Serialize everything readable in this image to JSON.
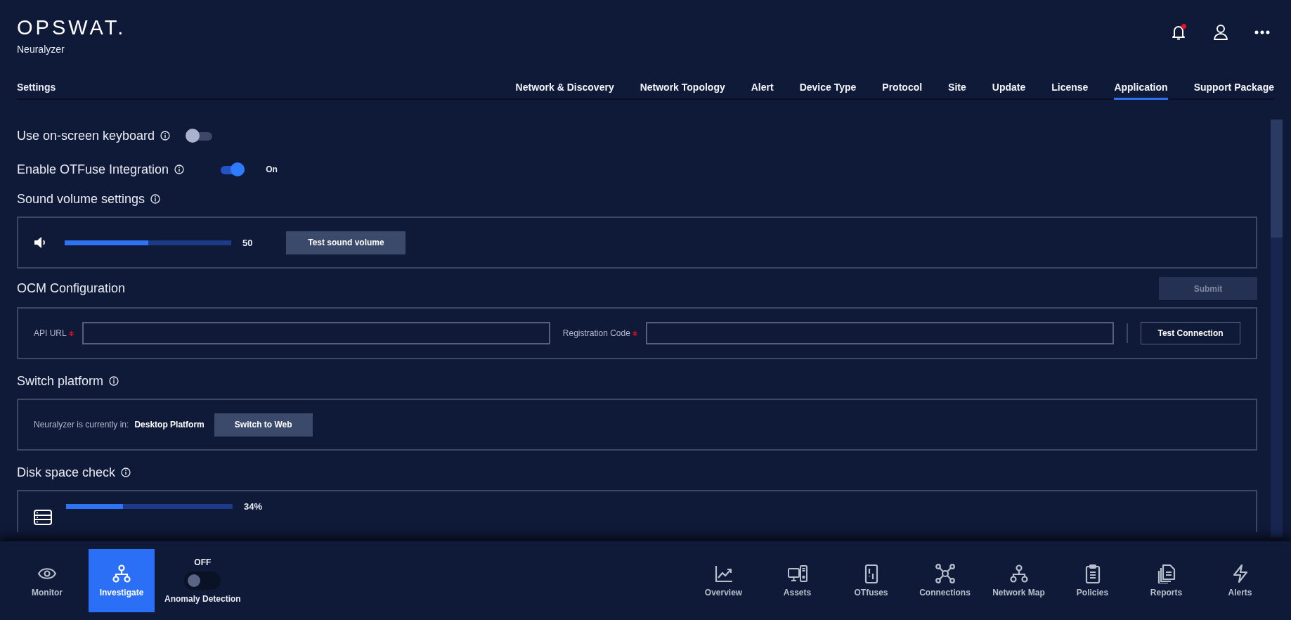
{
  "brand": {
    "logo": "OPSWAT.",
    "product": "Neuralyzer"
  },
  "notifications": {
    "unread": true
  },
  "settings_title": "Settings",
  "tabs": [
    {
      "label": "Network & Discovery",
      "selected": false
    },
    {
      "label": "Network Topology",
      "selected": false
    },
    {
      "label": "Alert",
      "selected": false
    },
    {
      "label": "Device Type",
      "selected": false
    },
    {
      "label": "Protocol",
      "selected": false
    },
    {
      "label": "Site",
      "selected": false
    },
    {
      "label": "Update",
      "selected": false
    },
    {
      "label": "License",
      "selected": false
    },
    {
      "label": "Application",
      "selected": true
    },
    {
      "label": "Support Package",
      "selected": false
    }
  ],
  "on_screen_keyboard": {
    "label": "Use on-screen keyboard",
    "on": false
  },
  "otfuse": {
    "label": "Enable OTFuse Integration",
    "on": true,
    "state_label": "On"
  },
  "sound": {
    "heading": "Sound volume settings",
    "level": 0.5,
    "reading": "50",
    "button": "Test sound volume"
  },
  "ocm": {
    "heading": "OCM Configuration",
    "submit": {
      "label": "Submit",
      "disabled": true
    },
    "fields": [
      {
        "label": "API URL",
        "required": true
      },
      {
        "label": "Registration Code",
        "required": true
      }
    ],
    "test_button": "Test Connection"
  },
  "platform": {
    "heading": "Switch platform",
    "current_label": "Neuralyzer is currently in:",
    "current_value": "Desktop Platform",
    "button": "Switch to Web"
  },
  "disk": {
    "heading": "Disk space check",
    "level": 0.34,
    "reading": "34%"
  },
  "bottom_nav": {
    "modes": [
      {
        "label": "Monitor",
        "selected": false
      },
      {
        "label": "Investigate",
        "selected": true
      }
    ],
    "anomaly": {
      "state_label": "OFF",
      "on": false,
      "label": "Anomaly Detection"
    },
    "pages": [
      "Overview",
      "Assets",
      "OTfuses",
      "Connections",
      "Network Map",
      "Policies",
      "Reports",
      "Alerts"
    ]
  }
}
